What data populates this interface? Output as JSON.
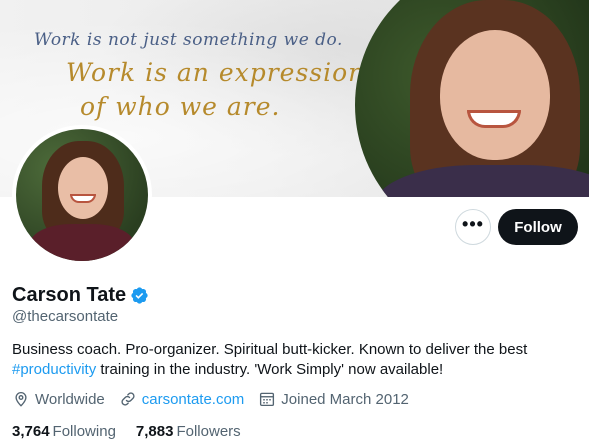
{
  "banner": {
    "quote_line_1": "Work is not just something we do.",
    "quote_line_2": "Work is an expression",
    "quote_line_3": "of who we are."
  },
  "actions": {
    "more_label": "•••",
    "follow_label": "Follow"
  },
  "profile": {
    "name": "Carson Tate",
    "handle": "@thecarsontate",
    "bio_part_1": "Business coach. Pro-organizer. Spiritual butt-kicker. Known to deliver the best ",
    "bio_hashtag": "#productivity",
    "bio_part_2": " training in the industry. 'Work Simply' now available!",
    "location": "Worldwide",
    "website": "carsontate.com",
    "joined": "Joined March 2012"
  },
  "stats": {
    "following_count": "3,764",
    "following_label": "Following",
    "followers_count": "7,883",
    "followers_label": "Followers"
  },
  "colors": {
    "accent": "#1d9bf0",
    "text_primary": "#0f1419",
    "text_secondary": "#536471",
    "follow_button": "#0f1419",
    "quote_blue": "#4a5f86",
    "quote_gold": "#b68a2c"
  },
  "icons": {
    "verified": "verified-badge-icon",
    "location": "location-pin-icon",
    "website": "link-icon",
    "joined": "calendar-icon",
    "more": "more-dots-icon"
  }
}
